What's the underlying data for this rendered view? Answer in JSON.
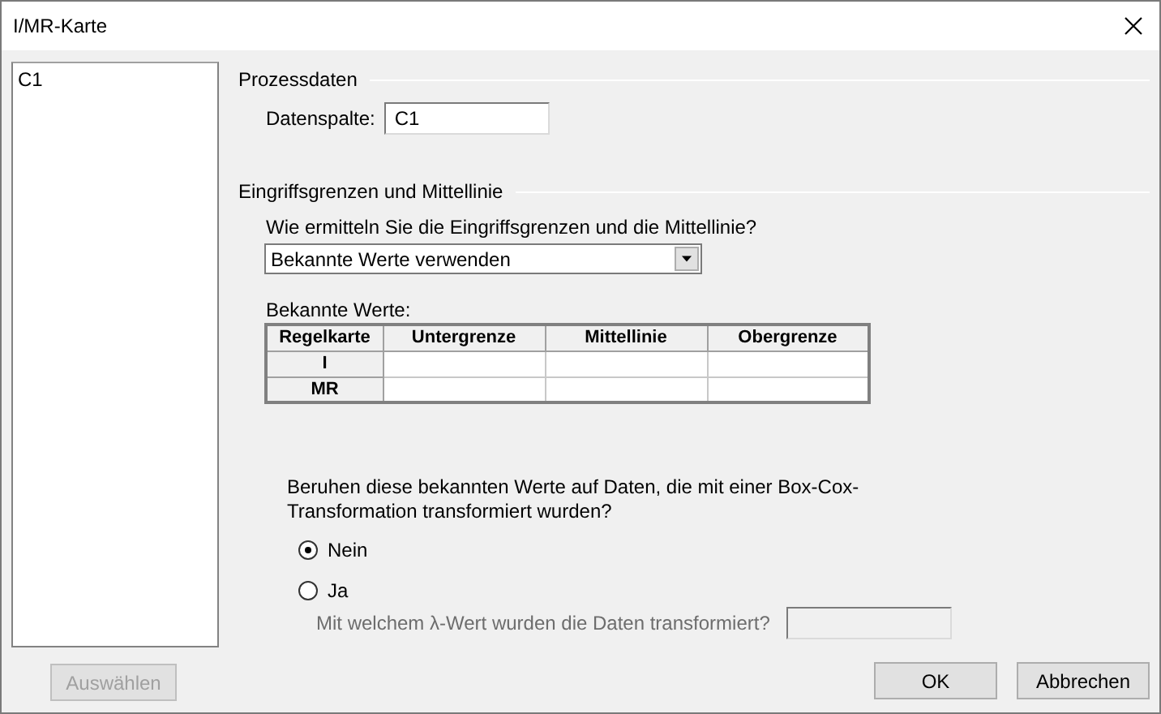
{
  "window": {
    "title": "I/MR-Karte"
  },
  "variables": [
    {
      "label": "C1",
      "selected": false
    }
  ],
  "select_button": {
    "label": "Auswählen",
    "disabled": true
  },
  "process_data": {
    "heading": "Prozessdaten",
    "data_column": {
      "label": "Datenspalte:",
      "value": "C1"
    }
  },
  "control_limits": {
    "heading": "Eingriffsgrenzen und Mittellinie",
    "question": "Wie ermitteln Sie die Eingriffsgrenzen und die Mittellinie?",
    "method": {
      "value": "Bekannte Werte verwenden"
    },
    "known_values": {
      "label": "Bekannte Werte:",
      "columns": [
        "Regelkarte",
        "Untergrenze",
        "Mittellinie",
        "Obergrenze"
      ],
      "rows": [
        {
          "label": "I"
        },
        {
          "label": "MR"
        }
      ]
    }
  },
  "box_cox": {
    "question": "Beruhen diese bekannten Werte auf Daten, die mit einer Box-Cox-Transformation transformiert wurden?",
    "options": [
      {
        "label": "Nein",
        "selected": true
      },
      {
        "label": "Ja",
        "selected": false
      }
    ],
    "lambda": {
      "label": "Mit welchem λ-Wert wurden die Daten transformiert?",
      "disabled": true
    }
  },
  "buttons": [
    {
      "label": "OK"
    },
    {
      "label": "Abbrechen"
    }
  ]
}
